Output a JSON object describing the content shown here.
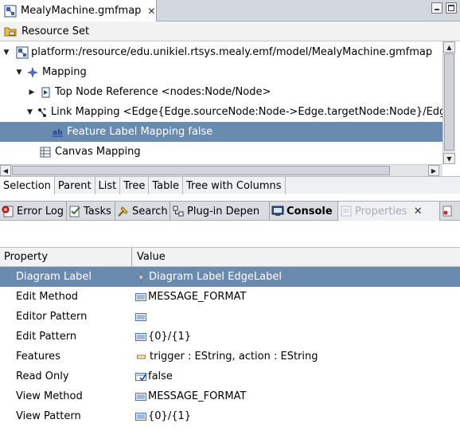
{
  "editor_tab": {
    "label": "MealyMachine.gmfmap"
  },
  "resource_header": {
    "label": "Resource Set"
  },
  "tree": {
    "items": [
      {
        "label": "platform:/resource/edu.unikiel.rtsys.mealy.emf/model/MealyMachine.gmfmap",
        "icon": "gmfmap-file-icon",
        "twisty": "expanded"
      },
      {
        "label": "Mapping",
        "icon": "mapping-icon",
        "twisty": "expanded"
      },
      {
        "label": "Top Node Reference <nodes:Node/Node>",
        "icon": "top-node-reference-icon",
        "twisty": "collapsed"
      },
      {
        "label": "Link Mapping <Edge{Edge.sourceNode:Node->Edge.targetNode:Node}/Edge",
        "icon": "link-mapping-icon",
        "twisty": "expanded"
      },
      {
        "label": "Feature Label Mapping false",
        "icon": "feature-label-mapping-icon",
        "twisty": "none",
        "selected": true
      },
      {
        "label": "Canvas Mapping",
        "icon": "canvas-mapping-icon",
        "twisty": "none"
      }
    ]
  },
  "editor_tabs": [
    {
      "label": "Selection",
      "active": true
    },
    {
      "label": "Parent"
    },
    {
      "label": "List"
    },
    {
      "label": "Tree"
    },
    {
      "label": "Table"
    },
    {
      "label": "Tree with Columns"
    }
  ],
  "view_tabs": [
    {
      "label": "Error Log",
      "icon": "error-log-icon"
    },
    {
      "label": "Tasks",
      "icon": "tasks-icon"
    },
    {
      "label": "Search",
      "icon": "search-icon"
    },
    {
      "label": "Plug-in Depen",
      "icon": "plugin-dependencies-icon"
    },
    {
      "label": "Console",
      "icon": "console-icon",
      "bold": true
    },
    {
      "label": "Properties",
      "icon": "properties-icon",
      "dim": true
    }
  ],
  "properties": {
    "header": {
      "property": "Property",
      "value": "Value"
    },
    "rows": [
      {
        "property": "Diagram Label",
        "value": "Diagram Label EdgeLabel",
        "icon": "diagram-label-icon",
        "selected": true
      },
      {
        "property": "Edit Method",
        "value": "MESSAGE_FORMAT",
        "icon": "enum-literal-icon"
      },
      {
        "property": "Editor Pattern",
        "value": "",
        "icon": "enum-literal-icon"
      },
      {
        "property": "Edit Pattern",
        "value": "{0}/{1}",
        "icon": "enum-literal-icon"
      },
      {
        "property": "Features",
        "value": "trigger : EString, action : EString",
        "icon": "feature-attribute-icon"
      },
      {
        "property": "Read Only",
        "value": "false",
        "icon": "boolean-check-icon"
      },
      {
        "property": "View Method",
        "value": "MESSAGE_FORMAT",
        "icon": "enum-literal-icon"
      },
      {
        "property": "View Pattern",
        "value": "{0}/{1}",
        "icon": "enum-literal-icon"
      }
    ]
  }
}
